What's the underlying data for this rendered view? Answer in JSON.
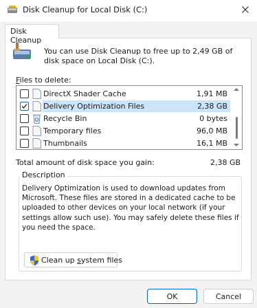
{
  "window": {
    "title": "Disk Cleanup for Local Disk (C:)",
    "close_icon": "close-icon"
  },
  "tab": {
    "label": "Disk Cleanup"
  },
  "intro": {
    "text": "You can use Disk Cleanup to free up to 2,49 GB of disk space on Local Disk (C:)."
  },
  "files": {
    "label_prefix": "F",
    "label_rest": "iles to delete:",
    "items": [
      {
        "name": "DirectX Shader Cache",
        "size": "1,91 MB",
        "checked": false,
        "icon": "file-icon"
      },
      {
        "name": "Delivery Optimization Files",
        "size": "2,38 GB",
        "checked": true,
        "selected": true,
        "icon": "file-icon"
      },
      {
        "name": "Recycle Bin",
        "size": "0 bytes",
        "checked": false,
        "icon": "recycle-bin-icon"
      },
      {
        "name": "Temporary files",
        "size": "96,0 MB",
        "checked": false,
        "icon": "file-icon"
      },
      {
        "name": "Thumbnails",
        "size": "16,1 MB",
        "checked": false,
        "icon": "file-icon"
      }
    ]
  },
  "total": {
    "label": "Total amount of disk space you gain:",
    "value": "2,38 GB"
  },
  "description": {
    "title": "Description",
    "text": "Delivery Optimization is used to download updates from Microsoft. These files are stored in a dedicated cache to be uploaded to other devices on your local network (if your settings allow such use). You may safely delete these files if you need the space."
  },
  "buttons": {
    "cleanup_pre": "Clean up ",
    "cleanup_ul": "s",
    "cleanup_post": "ystem files",
    "ok": "OK",
    "cancel": "Cancel"
  },
  "colors": {
    "accent": "#0067c0",
    "selection": "#cce4f7",
    "checkbox_checked": "#1a5fb4"
  }
}
